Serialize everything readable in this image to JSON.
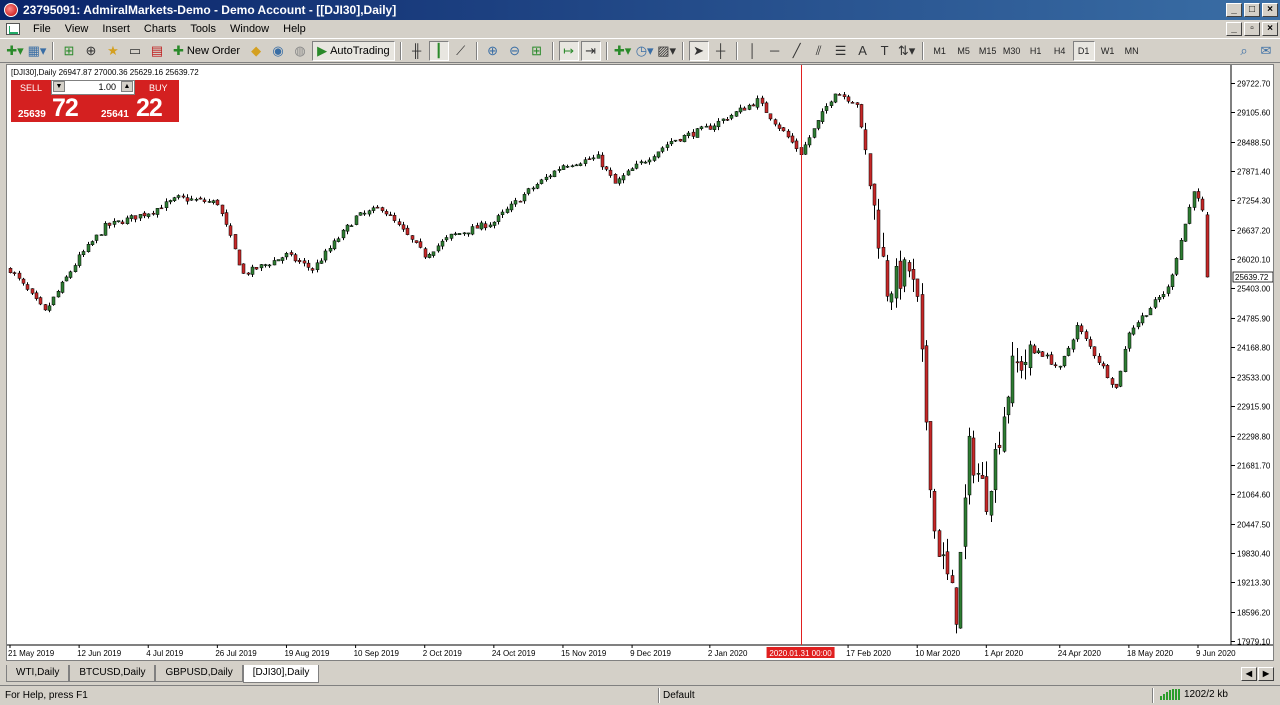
{
  "window": {
    "title": "23795091: AdmiralMarkets-Demo - Demo Account - [[DJI30],Daily]"
  },
  "menu": [
    "File",
    "View",
    "Insert",
    "Charts",
    "Tools",
    "Window",
    "Help"
  ],
  "toolbar": {
    "new_order_label": "New Order",
    "autotrading_label": "AutoTrading",
    "timeframes": [
      "M1",
      "M5",
      "M15",
      "M30",
      "H1",
      "H4",
      "D1",
      "W1",
      "MN"
    ],
    "active_timeframe": "D1"
  },
  "chart": {
    "header": "[DJI30],Daily  26947.87 27000.36 25629.16 25639.72",
    "symbol": "[DJI30],Daily",
    "ohlc": {
      "open": "26947.87",
      "high": "27000.36",
      "low": "25629.16",
      "close": "25639.72"
    },
    "current_price_label": "25639.72",
    "crosshair_date_label": "2020.01.31 00:00",
    "colors": {
      "bull": "#2e7d32",
      "bear": "#c62828",
      "crosshair": "#e02020",
      "price_tag_bg": "#ffffff"
    }
  },
  "trade_panel": {
    "sell_label": "SELL",
    "buy_label": "BUY",
    "lot_value": "1.00",
    "sell_price_prefix": "25639",
    "sell_price_big": "72",
    "buy_price_prefix": "25641",
    "buy_price_big": "22"
  },
  "tabs": [
    "WTI,Daily",
    "BTCUSD,Daily",
    "GBPUSD,Daily",
    "[DJI30],Daily"
  ],
  "active_tab": "[DJI30],Daily",
  "status": {
    "help": "For Help, press F1",
    "profile": "Default",
    "connection": "1202/2 kb"
  },
  "chart_data": {
    "type": "candlestick",
    "symbol": "[DJI30]",
    "timeframe": "Daily",
    "y_axis_ticks": [
      29722.7,
      29105.6,
      28488.5,
      27871.4,
      27254.3,
      26637.2,
      26020.1,
      25403.0,
      24785.9,
      24168.8,
      23533.0,
      22915.9,
      22298.8,
      21681.7,
      21064.6,
      20447.5,
      19830.4,
      19213.3,
      18596.2,
      17979.1
    ],
    "x_axis_labels": [
      "21 May 2019",
      "12 Jun 2019",
      "4 Jul 2019",
      "26 Jul 2019",
      "19 Aug 2019",
      "10 Sep 2019",
      "2 Oct 2019",
      "24 Oct 2019",
      "15 Nov 2019",
      "9 Dec 2019",
      "2 Jan 2020",
      "2020.01.31 00:00",
      "17 Feb 2020",
      "10 Mar 2020",
      "1 Apr 2020",
      "24 Apr 2020",
      "18 May 2020",
      "9 Jun 2020"
    ],
    "ylim": [
      17979.1,
      29722.7
    ],
    "approx_close_path": [
      [
        "2019-05-21",
        25800
      ],
      [
        "2019-05-31",
        24900
      ],
      [
        "2019-06-12",
        26050
      ],
      [
        "2019-06-20",
        26700
      ],
      [
        "2019-07-04",
        27000
      ],
      [
        "2019-07-15",
        27300
      ],
      [
        "2019-07-26",
        27200
      ],
      [
        "2019-08-05",
        25700
      ],
      [
        "2019-08-19",
        26100
      ],
      [
        "2019-08-27",
        25800
      ],
      [
        "2019-09-10",
        26900
      ],
      [
        "2019-09-18",
        27100
      ],
      [
        "2019-10-02",
        26100
      ],
      [
        "2019-10-10",
        26500
      ],
      [
        "2019-10-24",
        26800
      ],
      [
        "2019-11-05",
        27450
      ],
      [
        "2019-11-15",
        28000
      ],
      [
        "2019-11-27",
        28150
      ],
      [
        "2019-12-03",
        27600
      ],
      [
        "2019-12-09",
        27900
      ],
      [
        "2019-12-20",
        28500
      ],
      [
        "2020-01-02",
        28800
      ],
      [
        "2020-01-17",
        29350
      ],
      [
        "2020-01-31",
        28250
      ],
      [
        "2020-02-12",
        29550
      ],
      [
        "2020-02-19",
        29300
      ],
      [
        "2020-02-28",
        25400
      ],
      [
        "2020-03-06",
        25800
      ],
      [
        "2020-03-10",
        25000
      ],
      [
        "2020-03-16",
        20300
      ],
      [
        "2020-03-23",
        18600
      ],
      [
        "2020-03-26",
        22000
      ],
      [
        "2020-04-01",
        21000
      ],
      [
        "2020-04-09",
        23700
      ],
      [
        "2020-04-17",
        24100
      ],
      [
        "2020-04-24",
        23700
      ],
      [
        "2020-04-30",
        24600
      ],
      [
        "2020-05-13",
        23300
      ],
      [
        "2020-05-18",
        24500
      ],
      [
        "2020-05-29",
        25400
      ],
      [
        "2020-06-05",
        27100
      ],
      [
        "2020-06-08",
        27500
      ],
      [
        "2020-06-10",
        27000
      ],
      [
        "2020-06-11",
        25640
      ]
    ]
  }
}
